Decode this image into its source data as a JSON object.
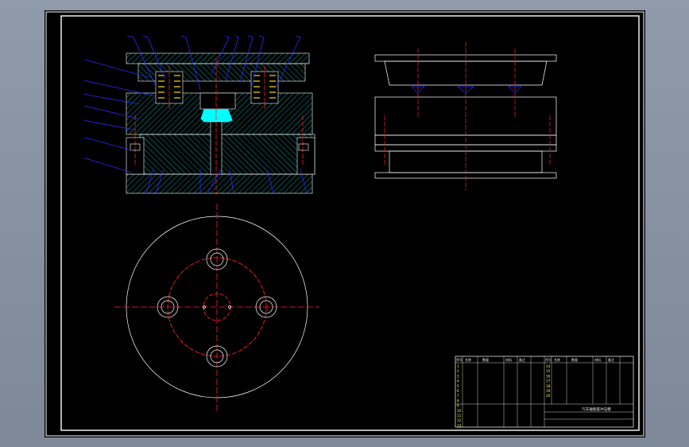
{
  "app": {
    "background_color": "#8a96a6",
    "canvas_color": "#000000"
  },
  "drawing": {
    "section_view": {
      "name": "die-assembly-section"
    },
    "side_view": {
      "name": "die-side-view"
    },
    "plan_view": {
      "name": "bottom-plate-plan"
    },
    "colors": {
      "line": "#ffffff",
      "hatch": "#00c8c8",
      "centerline": "#ff2020",
      "leader": "#2a2aff",
      "spring": "#ffe000",
      "part": "#00ffff"
    }
  },
  "bom": {
    "headers_left": [
      "序号",
      "名称",
      "数量",
      "材料",
      "备注"
    ],
    "headers_right": [
      "序号",
      "名称",
      "数量",
      "材料",
      "备注"
    ],
    "left_numbers": [
      "1",
      "2",
      "3",
      "4",
      "5",
      "6",
      "7",
      "8",
      "9",
      "10",
      "11",
      "12",
      "13"
    ],
    "right_numbers": [
      "14",
      "15",
      "16",
      "17",
      "18",
      "19",
      "20"
    ]
  },
  "title_block": {
    "title": "汽车轴套座冲压模"
  }
}
